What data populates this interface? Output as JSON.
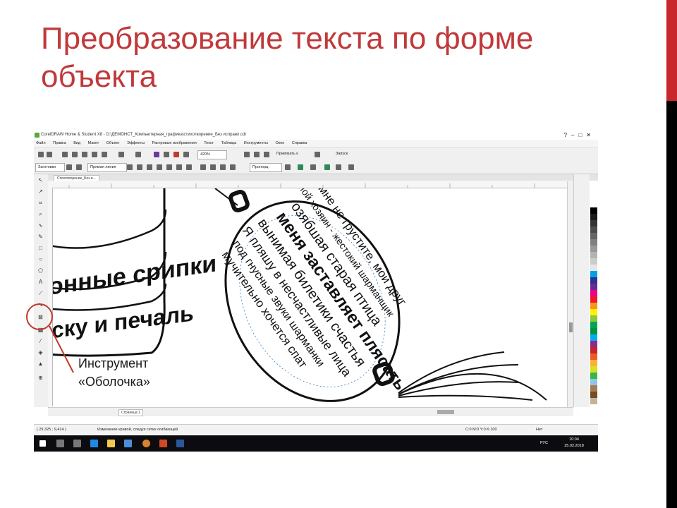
{
  "slide": {
    "title": "Преобразование текста по форме объекта",
    "caption_line1": "Инструмент",
    "caption_line2": "«Оболочка»",
    "title_color": "#c0393b",
    "annotation_color": "#c0392b"
  },
  "app": {
    "window_title": "CorelDRAW Home & Student X8 - D:\\ДЕМОНСТ_Компьютерная_графика\\стихотворение_Без исправл.cdr",
    "menu": [
      "Файл",
      "Правка",
      "Вид",
      "Макет",
      "Объект",
      "Эффекты",
      "Растровые изображения",
      "Текст",
      "Таблица",
      "Инструменты",
      "Окно",
      "Справка"
    ],
    "toolbar": {
      "zoom": "420%",
      "snap_label": "Привязать к",
      "launch_label": "Запуск"
    },
    "propertybar": {
      "preset_label": "Заготовки",
      "mode_label": "Прямая линия",
      "mapping_label": "Пропорц."
    },
    "document_tab": "Стихотворение_Без и...",
    "page_tab": "Страница 1",
    "status": {
      "coords": "( 29,325 ; 9,414 )",
      "hint": "Изменение кривой, следуя сетке огибающей",
      "fill_info": "C:0 M:0 Y:0 K:100",
      "none_label": "Нет"
    },
    "taskbar": {
      "time": "10:04",
      "date": "25.02.2018",
      "lang": "РУС"
    }
  },
  "canvas_text": {
    "can_line1": "онные срипки",
    "can_line2": "ску и печаль",
    "balloon_line1": "Со мне не грустите, мои друг",
    "balloon_line2": "Мой хозяин - жестокий шарманщик",
    "balloon_line3": "озябшая старая птица",
    "balloon_line4": "меня заставляет плясать",
    "balloon_line5": "вынимая билетики счастья",
    "balloon_line6": "Я пляшу в несчастливые лица",
    "balloon_line7": "под гнусные звуки шарманки",
    "balloon_line8": "мучительно хочется спат"
  },
  "palette_colors": [
    "#ffffff",
    "#000000",
    "#1a1a1a",
    "#333333",
    "#4d4d4d",
    "#666666",
    "#808080",
    "#999999",
    "#b3b3b3",
    "#cccccc",
    "#e6e6e6",
    "#00a0e3",
    "#2e3192",
    "#662d91",
    "#ec008c",
    "#ed1c24",
    "#f7941d",
    "#fff200",
    "#8dc63f",
    "#00a651",
    "#009444",
    "#00aeef",
    "#92278f",
    "#c1272d",
    "#f15a24",
    "#fbb03b",
    "#d9e021",
    "#39b54a",
    "#8cc6e8",
    "#a67c52",
    "#754c24",
    "#c7b299"
  ]
}
